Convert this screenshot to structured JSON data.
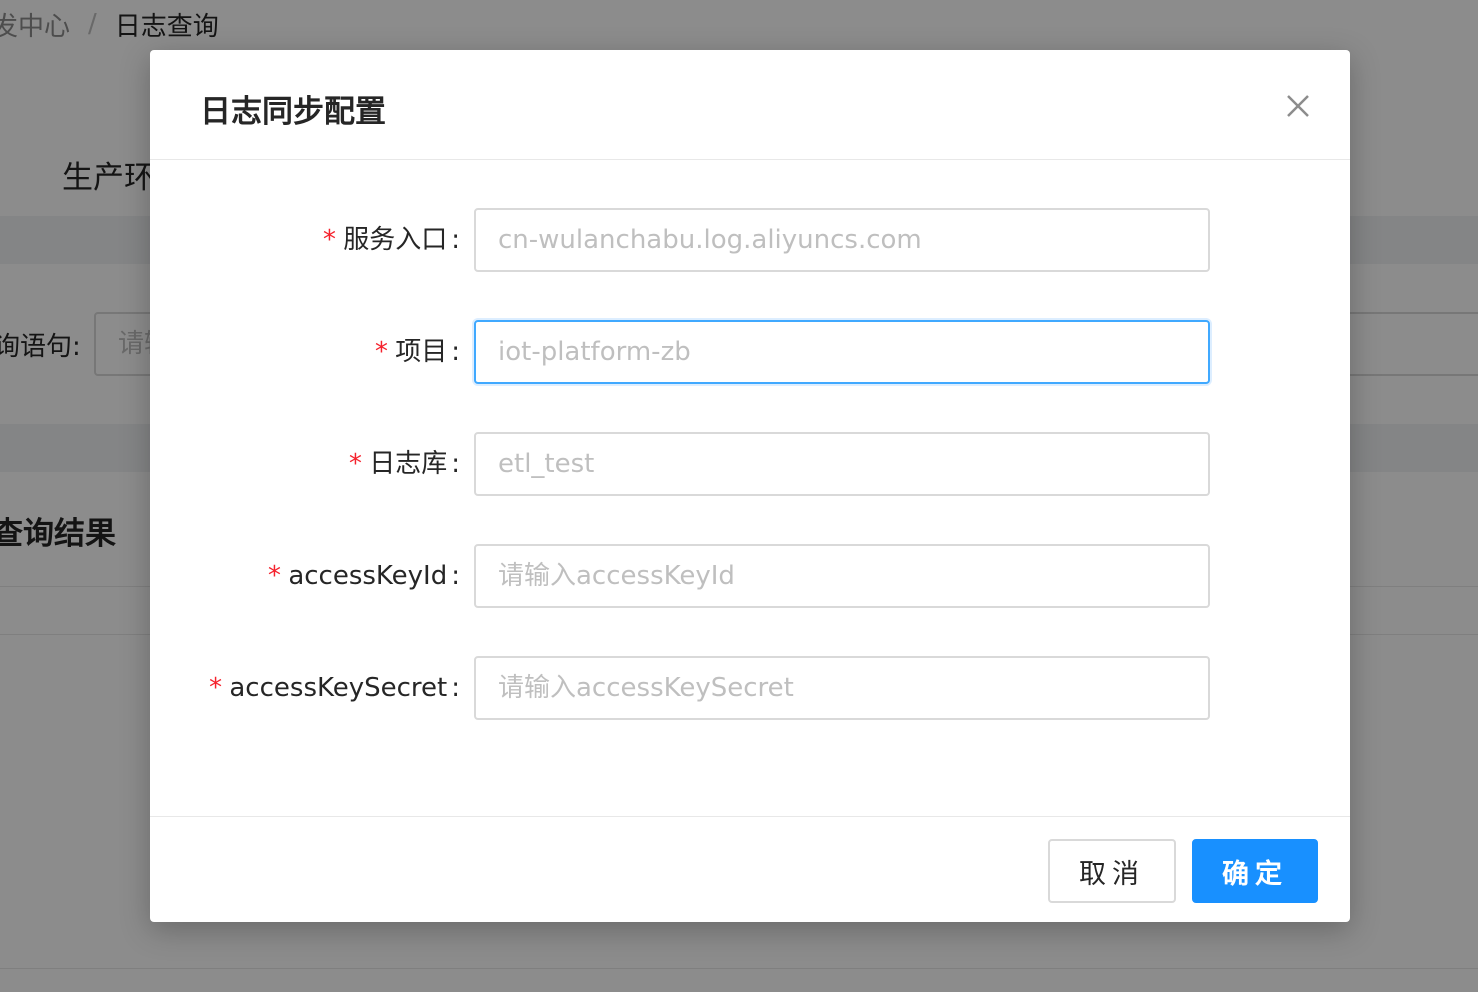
{
  "background": {
    "breadcrumb": {
      "parent": "发中心",
      "separator": "/",
      "current": "日志查询"
    },
    "env_label": "生产环",
    "query_label": "询语句:",
    "query_placeholder": "请输",
    "results_title": "查询结果"
  },
  "modal": {
    "title": "日志同步配置",
    "close_icon": "close-icon",
    "fields": [
      {
        "label": "服务入口",
        "value": "",
        "placeholder": "cn-wulanchabu.log.aliyuncs.com",
        "required": true,
        "focused": false
      },
      {
        "label": "项目",
        "value": "",
        "placeholder": "iot-platform-zb",
        "required": true,
        "focused": true
      },
      {
        "label": "日志库",
        "value": "",
        "placeholder": "etl_test",
        "required": true,
        "focused": false
      },
      {
        "label": "accessKeyId",
        "value": "",
        "placeholder": "请输入accessKeyId",
        "required": true,
        "focused": false
      },
      {
        "label": "accessKeySecret",
        "value": "",
        "placeholder": "请输入accessKeySecret",
        "required": true,
        "focused": false
      }
    ],
    "required_mark": "*",
    "colon": ":",
    "cancel_label": "取消",
    "ok_label": "确定"
  },
  "colors": {
    "primary": "#1890ff",
    "focus_border": "#40a9ff",
    "required": "#f5222d",
    "mask": "rgba(0,0,0,0.45)"
  }
}
